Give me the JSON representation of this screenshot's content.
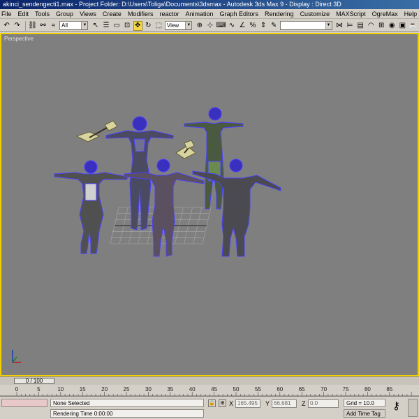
{
  "window": {
    "title": "akinci_sendengecti1.max - Project Folder: D:\\Users\\Toliga\\Documents\\3dsmax - Autodesk 3ds Max 9 - Display : Direct 3D"
  },
  "menu": [
    "File",
    "Edit",
    "Tools",
    "Group",
    "Views",
    "Create",
    "Modifiers",
    "reactor",
    "Animation",
    "Graph Editors",
    "Rendering",
    "Customize",
    "MAXScript",
    "OgreMax",
    "Help"
  ],
  "toolbar": {
    "selection_filter": "All",
    "reference_coord": "View",
    "named_selection": ""
  },
  "viewport": {
    "label": "Perspective"
  },
  "timeslider": {
    "frame_display": "0 / 100"
  },
  "trackbar": {
    "ticks": [
      "0",
      "5",
      "10",
      "15",
      "20",
      "25",
      "30",
      "35",
      "40",
      "45",
      "50",
      "55",
      "60",
      "65",
      "70",
      "75",
      "80",
      "85"
    ]
  },
  "status": {
    "selection": "None Selected",
    "rendering_time": "Rendering Time  0:00:00",
    "x_label": "X",
    "x_value": "165.495",
    "y_label": "Y",
    "y_value": "66.681",
    "z_label": "Z",
    "z_value": "0.0",
    "grid": "Grid = 10.0",
    "add_time_tag": "Add Time Tag"
  },
  "colors": {
    "viewport_bg": "#7f7f7f",
    "active_border": "#f0d000",
    "wireframe": "#4a40ff"
  }
}
